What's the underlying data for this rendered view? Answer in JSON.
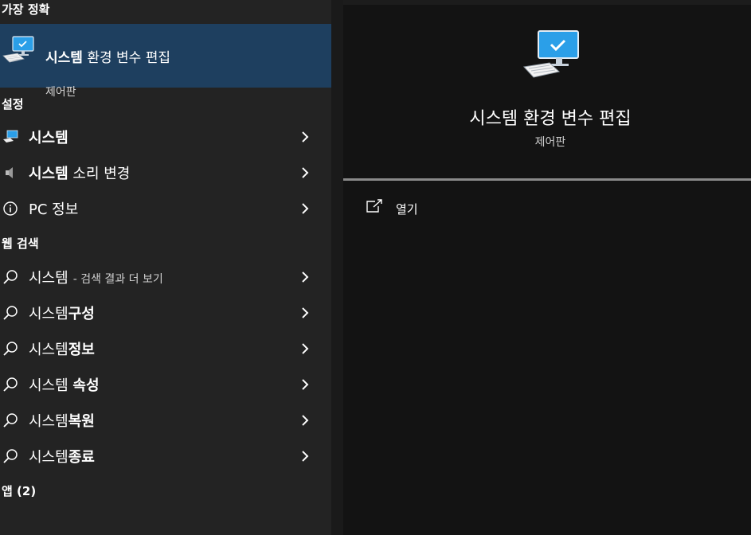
{
  "sections": {
    "best_match": "가장 정확",
    "settings": "설정",
    "web_search": "웹 검색",
    "apps": "앱 (2)"
  },
  "best_match": {
    "title_bold": "시스템",
    "title_rest": " 환경 변수 편집",
    "subtitle": "제어판",
    "icon": "monitor-check-icon"
  },
  "settings_items": [
    {
      "bold": "시스템",
      "rest": "",
      "icon": "monitor-icon"
    },
    {
      "bold": "시스템",
      "rest": " 소리 변경",
      "icon": "speaker-icon"
    },
    {
      "bold": "",
      "rest": "PC 정보",
      "icon": "info-icon"
    }
  ],
  "web_items": [
    {
      "normal": "시스템",
      "small": "- 검색 결과 더 보기",
      "bold": "",
      "icon": "search-icon"
    },
    {
      "normal": "시스템",
      "small": "",
      "bold": "구성",
      "icon": "search-icon"
    },
    {
      "normal": "시스템",
      "small": "",
      "bold": "정보",
      "icon": "search-icon"
    },
    {
      "normal": "시스템 ",
      "small": "",
      "bold": "속성",
      "icon": "search-icon"
    },
    {
      "normal": "시스템",
      "small": "",
      "bold": "복원",
      "icon": "search-icon"
    },
    {
      "normal": "시스템",
      "small": "",
      "bold": "종료",
      "icon": "search-icon"
    }
  ],
  "preview": {
    "title": "시스템 환경 변수 편집",
    "subtitle": "제어판",
    "open_label": "열기"
  },
  "colors": {
    "selected_bg": "#1e3f5f",
    "left_bg": "#232323",
    "right_bg": "#131313",
    "monitor_blue": "#2b9fe8"
  }
}
